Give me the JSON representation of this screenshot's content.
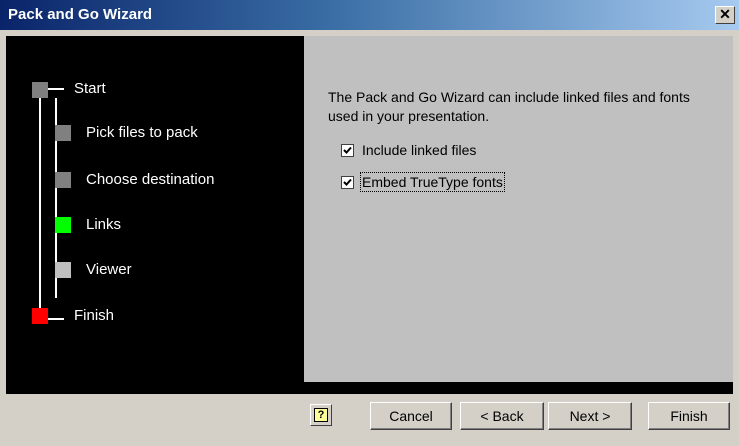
{
  "window": {
    "title": "Pack and Go Wizard",
    "close_label": "✕"
  },
  "steps": [
    {
      "label": "Start",
      "color": "#808080"
    },
    {
      "label": "Pick files to pack",
      "color": "#808080"
    },
    {
      "label": "Choose destination",
      "color": "#808080"
    },
    {
      "label": "Links",
      "color": "#00ff00"
    },
    {
      "label": "Viewer",
      "color": "#c0c0c0"
    },
    {
      "label": "Finish",
      "color": "#ff0000"
    }
  ],
  "main": {
    "description": "The Pack and Go Wizard can include linked files and fonts used in your presentation.",
    "options": [
      {
        "label": "Include linked files",
        "checked": true
      },
      {
        "label": "Embed TrueType fonts",
        "checked": true
      }
    ]
  },
  "buttons": {
    "help": "?",
    "cancel": "Cancel",
    "back": "< Back",
    "next": "Next >",
    "finish": "Finish"
  }
}
